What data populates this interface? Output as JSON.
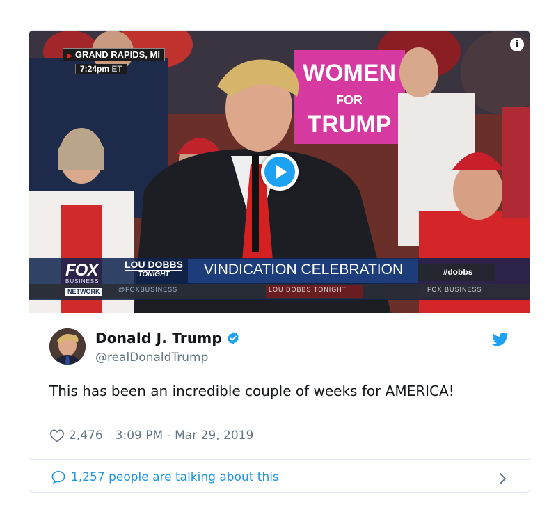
{
  "video": {
    "location_city": "GRAND RAPIDS, MI",
    "location_time": "7:24pm",
    "location_tz": "ET",
    "sign_text_1": "WOMEN",
    "sign_text_2": "FOR",
    "sign_text_3": "TRUMP",
    "network_logo": "FOX",
    "network_sub": "BUSINESS",
    "network_label": "NETWORK",
    "show_name_1": "LOU DOBBS",
    "show_name_2": "TONIGHT",
    "headline": "VINDICATION CELEBRATION",
    "hashtag": "#dobbs",
    "ticker_left": "@FOXBUSINESS",
    "ticker_mid": "LOU DOBBS TONIGHT",
    "ticker_right": "FOX BUSINESS",
    "info_icon": "info-icon",
    "play_icon": "play-icon"
  },
  "tweet": {
    "author_name": "Donald J. Trump",
    "author_handle": "@realDonaldTrump",
    "text": "This has been an incredible couple of weeks for AMERICA!",
    "likes": "2,476",
    "timestamp": "3:09 PM - Mar 29, 2019",
    "talking": "1,257 people are talking about this",
    "icons": [
      "verified-badge-icon",
      "twitter-bird-icon",
      "heart-icon",
      "speech-bubble-icon",
      "chevron-right-icon"
    ]
  },
  "colors": {
    "twitter_blue": "#1da1f2",
    "link_blue": "#1b95e0",
    "text_gray": "#657786",
    "border": "#e1e8ed",
    "sign_pink": "#d63aa0",
    "fox_banner": "#1c3c7a"
  }
}
